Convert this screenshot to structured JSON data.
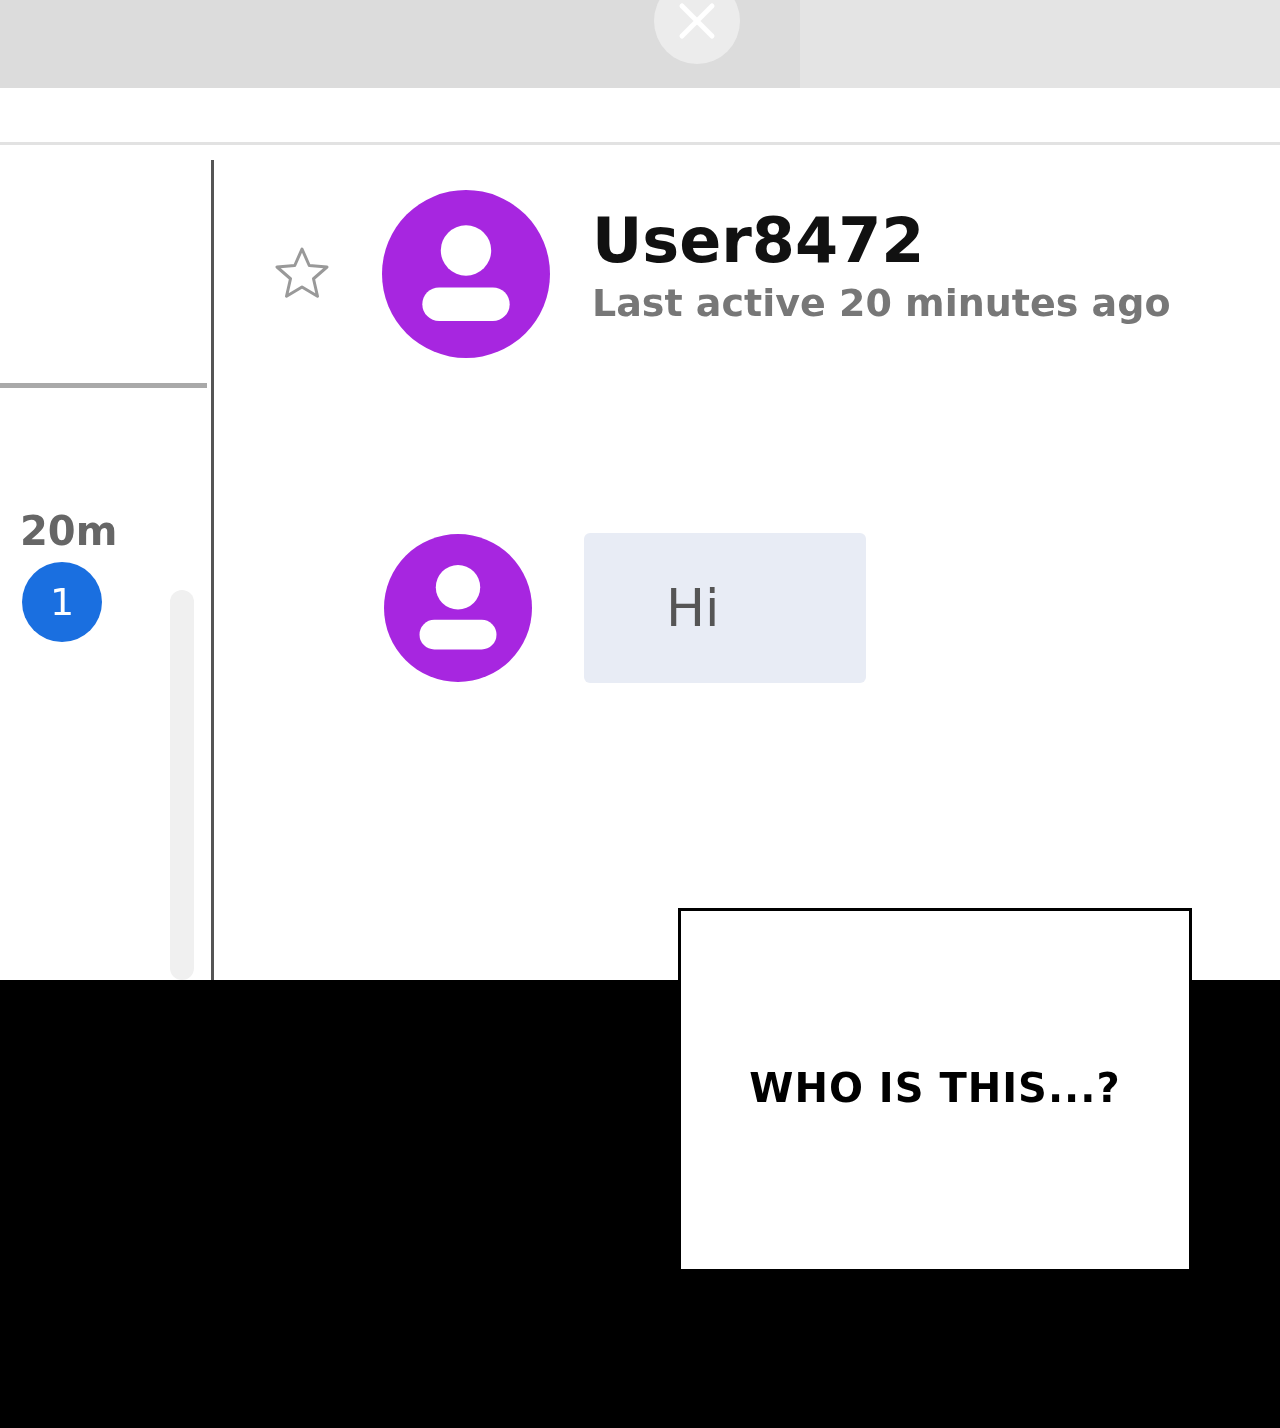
{
  "sidebar": {
    "time": "20m",
    "unread_count": "1"
  },
  "chat": {
    "starred": false,
    "name": "User8472",
    "status": "Last active 20 minutes ago",
    "messages": [
      {
        "text": "Hi"
      }
    ]
  },
  "caption": "WHO IS THIS...?"
}
